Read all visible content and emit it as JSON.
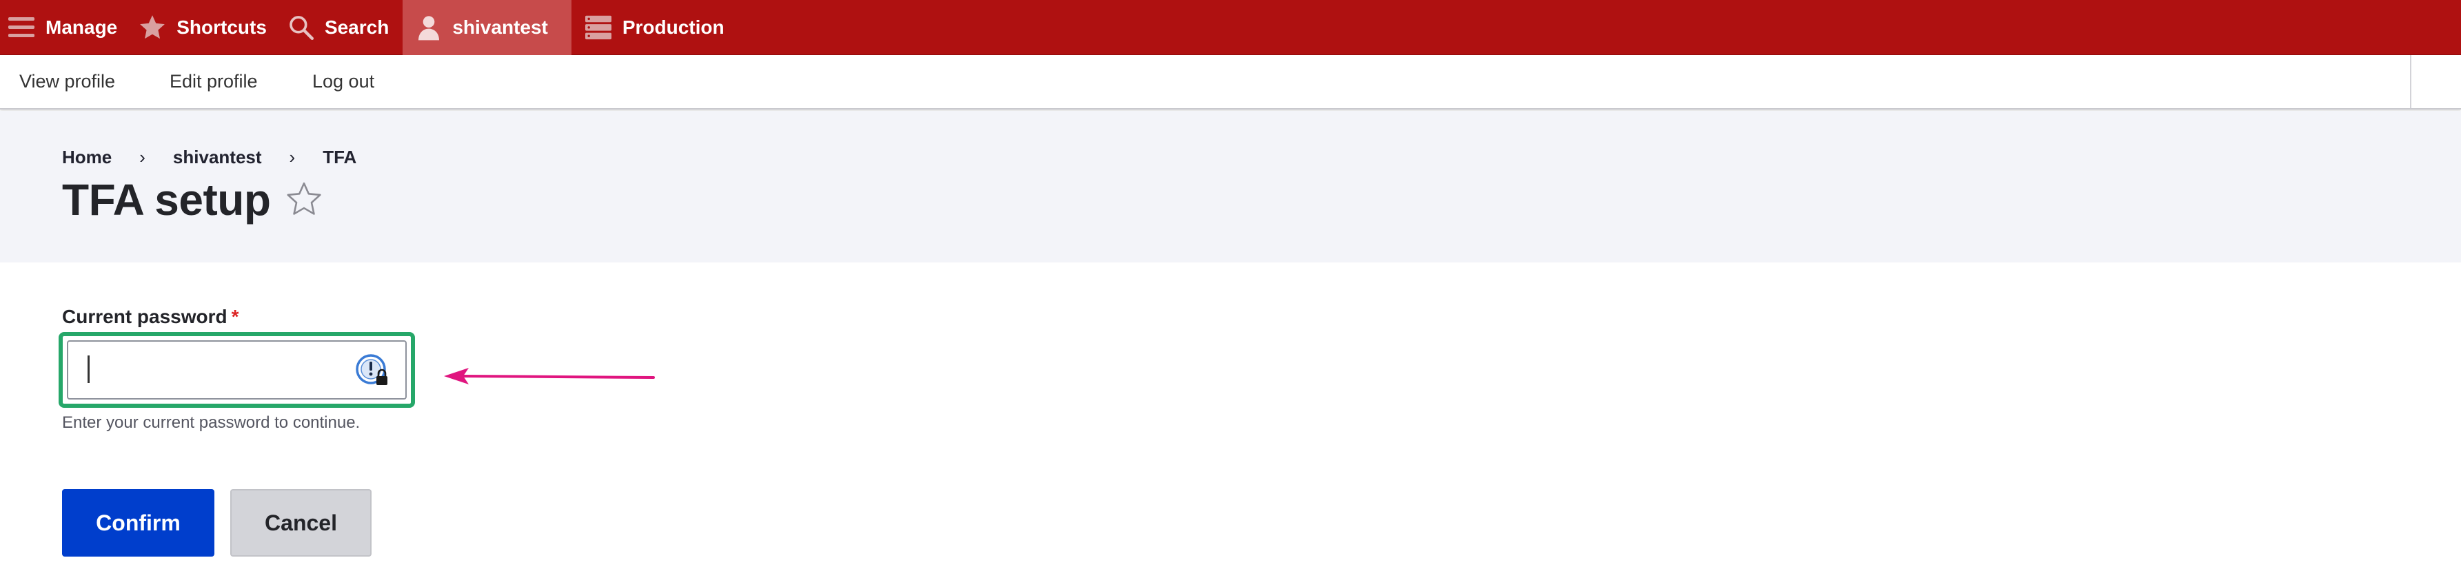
{
  "toolbar": {
    "items": [
      {
        "label": "Manage",
        "icon": "hamburger-icon"
      },
      {
        "label": "Shortcuts",
        "icon": "star-icon"
      },
      {
        "label": "Search",
        "icon": "search-icon"
      },
      {
        "label": "shivantest",
        "icon": "user-icon",
        "active": true
      },
      {
        "label": "Production",
        "icon": "server-icon"
      }
    ],
    "background_color": "#af1111",
    "active_color": "#c74b4b"
  },
  "tray": {
    "links": [
      "View profile",
      "Edit profile",
      "Log out"
    ]
  },
  "breadcrumb": {
    "items": [
      "Home",
      "shivantest",
      "TFA"
    ],
    "separator": "›"
  },
  "page": {
    "title": "TFA setup",
    "favorite_icon": "star-outline-icon"
  },
  "form": {
    "password_label": "Current password",
    "required_marker": "*",
    "password_value": "",
    "help_text": "Enter your current password to continue.",
    "confirm_label": "Confirm",
    "cancel_label": "Cancel",
    "focus_ring_color": "#26a769",
    "password_manager_icon": "password-manager-icon"
  },
  "annotation": {
    "arrow_icon": "pointer-arrow-icon",
    "arrow_color": "#e0157f"
  }
}
